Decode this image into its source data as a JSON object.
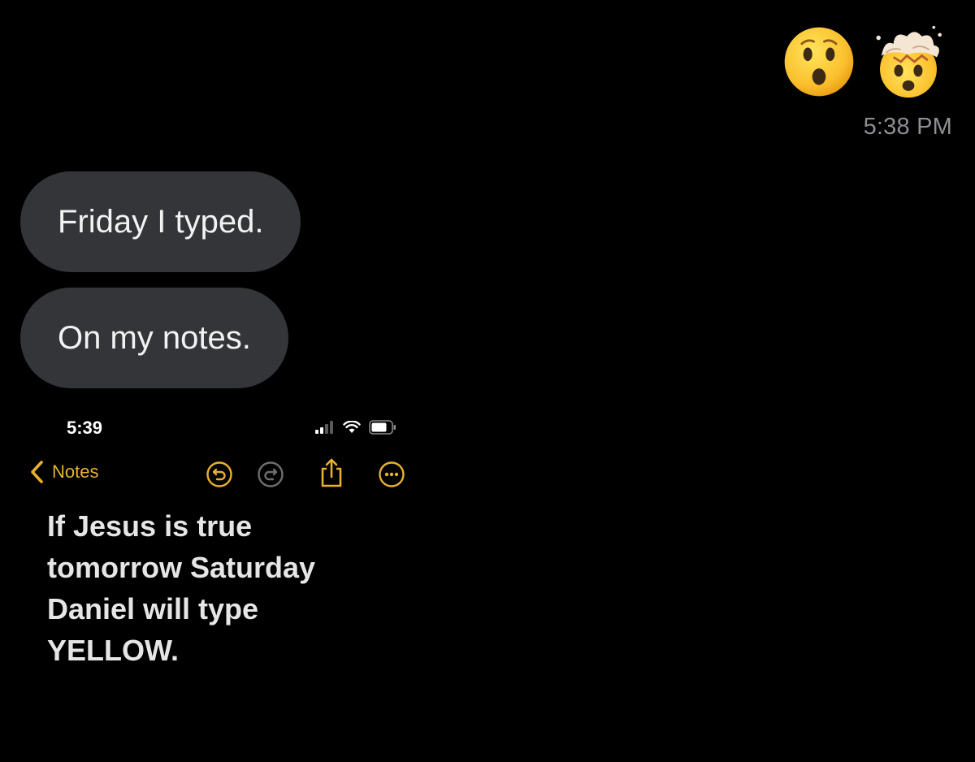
{
  "message": {
    "reactions": [
      {
        "icon": "astonished-face-emoji"
      },
      {
        "icon": "exploding-head-emoji"
      }
    ],
    "timestamp": "5:38 PM",
    "bubbles": [
      {
        "text": "Friday I typed."
      },
      {
        "text": "On my notes."
      }
    ]
  },
  "screenshot": {
    "status_bar": {
      "time": "5:39",
      "icons": [
        "signal-icon",
        "wifi-icon",
        "battery-icon"
      ]
    },
    "nav": {
      "back_label": "Notes",
      "toolbar_icons": [
        "undo-icon",
        "redo-icon",
        "share-icon",
        "more-icon"
      ]
    },
    "note": {
      "text": "If Jesus is true\ntomorrow Saturday\nDaniel will type\nYELLOW."
    }
  },
  "colors": {
    "background": "#000000",
    "bubble": "#343538",
    "accent": "#e7b130",
    "timestamp": "#8e8e93"
  }
}
